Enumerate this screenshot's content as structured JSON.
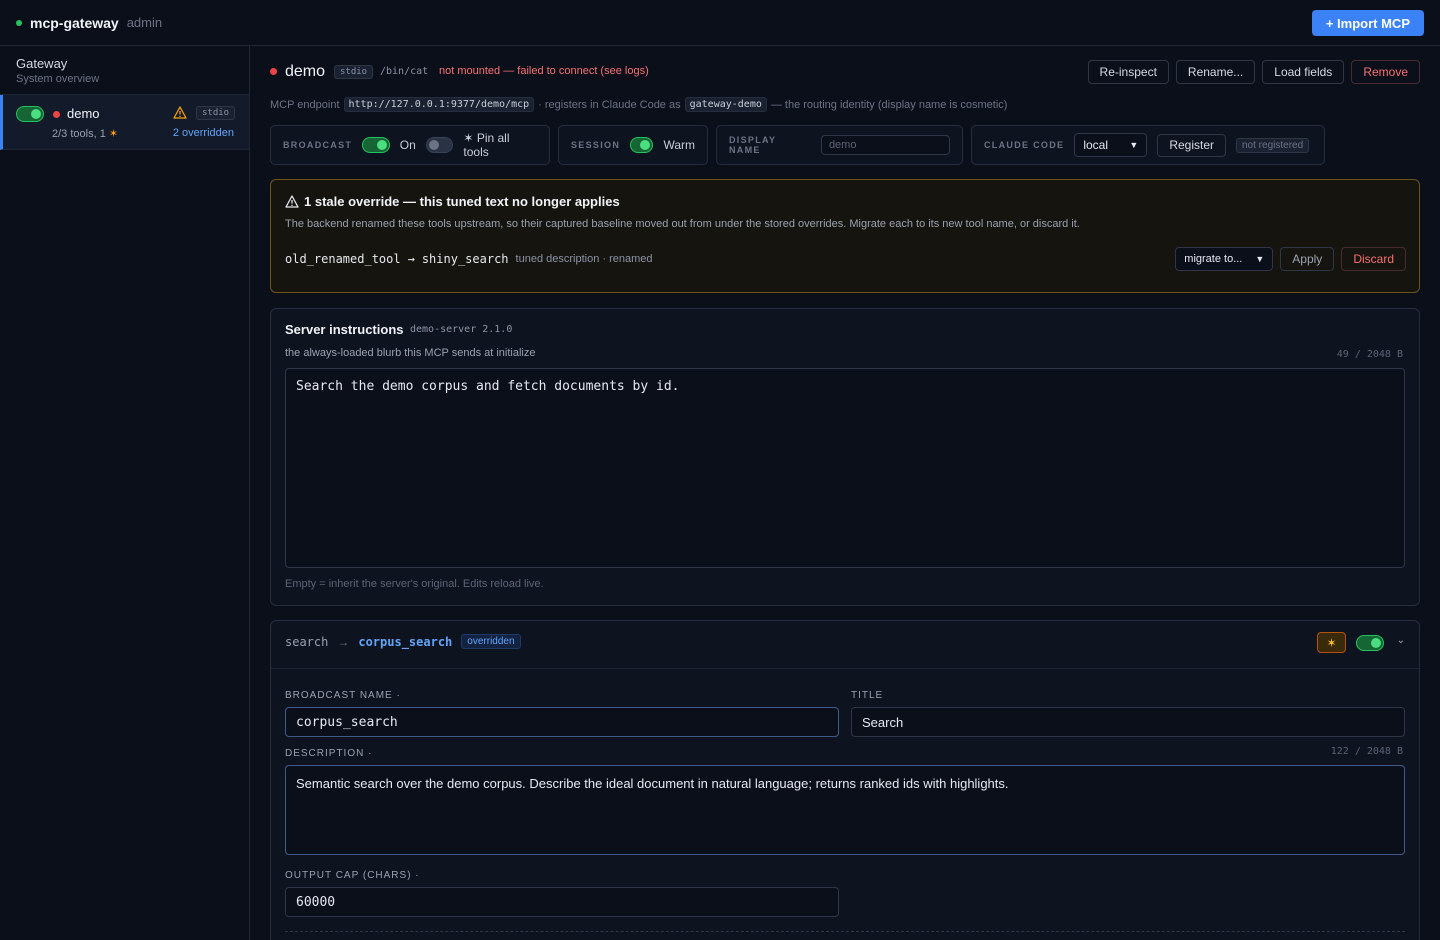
{
  "app": {
    "name": "mcp-gateway",
    "role": "admin",
    "import_label": "+ Import MCP"
  },
  "sidebar": {
    "title": "Gateway",
    "subtitle": "System overview",
    "servers": [
      {
        "name": "demo",
        "transport": "stdio",
        "tools_summary": "2/3 tools, 1",
        "overridden": "2 overridden"
      }
    ]
  },
  "server": {
    "name": "demo",
    "transport": "stdio",
    "command": "/bin/cat",
    "status_text": "not mounted — failed to connect (see logs)",
    "actions": [
      "Re-inspect",
      "Rename...",
      "Load fields",
      "Remove"
    ],
    "endpoint_label": "MCP endpoint",
    "endpoint_url": "http://127.0.0.1:9377/demo/mcp",
    "registers_text": "· registers in Claude Code as",
    "registered_name": "gateway-demo",
    "routing_note": "— the routing identity (display name is cosmetic)"
  },
  "controls": {
    "broadcast_label": "BROADCAST",
    "broadcast_state": "On",
    "pin_label": "Pin all tools",
    "session_label": "SESSION",
    "session_state": "Warm",
    "display_name_label": "DISPLAY NAME",
    "display_name_placeholder": "demo",
    "claude_code_label": "CLAUDE CODE",
    "claude_code_selected": "local",
    "register_label": "Register",
    "registration_status": "not registered"
  },
  "stale": {
    "title": "1 stale override — this tuned text no longer applies",
    "description": "The backend renamed these tools upstream, so their captured baseline moved out from under the stored overrides. Migrate each to its new tool name, or discard it.",
    "old_name": "old_renamed_tool",
    "arrow": "→",
    "new_name": "shiny_search",
    "meta": "tuned description · renamed",
    "migrate_selected": "migrate to...",
    "apply_label": "Apply",
    "discard_label": "Discard"
  },
  "instructions": {
    "title": "Server instructions",
    "version": "demo-server 2.1.0",
    "subtitle": "the always-loaded blurb this MCP sends at initialize",
    "counter": "49 / 2048 B",
    "value": "Search the demo corpus and fetch documents by id.",
    "hint": "Empty = inherit the server's original. Edits reload live."
  },
  "tool": {
    "original": "search",
    "arrow": "→",
    "broadcast": "corpus_search",
    "badge": "overridden",
    "broadcast_name_label": "BROADCAST NAME ·",
    "broadcast_name_value": "corpus_search",
    "title_label": "TITLE",
    "title_value": "Search",
    "description_label": "DESCRIPTION ·",
    "description_counter": "122 / 2048 B",
    "description_value": "Semantic search over the demo corpus. Describe the ideal document in natural language; returns ranked ids with highlights.",
    "output_cap_label": "OUTPUT CAP (CHARS) ·",
    "output_cap_value": "60000"
  },
  "colors": {
    "accent": "#3b82f6",
    "success": "#22c55e",
    "danger": "#ef4444",
    "warning": "#f59e0b"
  }
}
